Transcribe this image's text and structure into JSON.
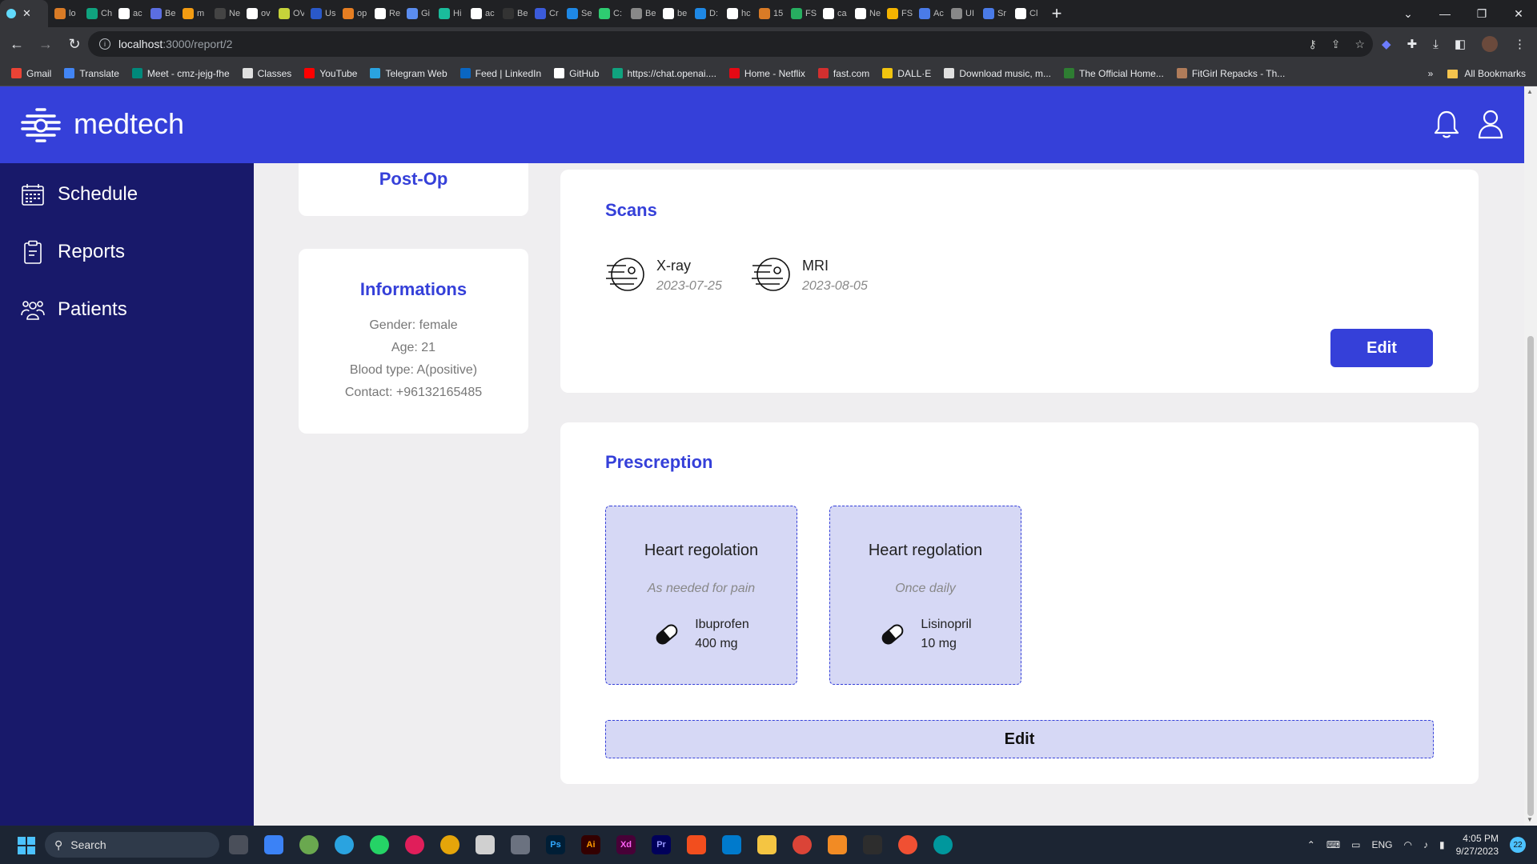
{
  "browser": {
    "tabs": [
      {
        "label": "lo",
        "color": "#d97b26"
      },
      {
        "label": "Ch",
        "color": "#10a37f"
      },
      {
        "label": "ac",
        "color": "#ffffff"
      },
      {
        "label": "Be",
        "color": "#5b6ee1"
      },
      {
        "label": "m",
        "color": "#f39c12"
      },
      {
        "label": "Ne",
        "color": "#444444"
      },
      {
        "label": "ov",
        "color": "#ffffff"
      },
      {
        "label": "OV",
        "color": "#c6d33a"
      },
      {
        "label": "Us",
        "color": "#2a59c9"
      },
      {
        "label": "op",
        "color": "#e67e22"
      },
      {
        "label": "Re",
        "color": "#ffffff"
      },
      {
        "label": "Gi",
        "color": "#5b8def"
      },
      {
        "label": "Hi",
        "color": "#1abc9c"
      },
      {
        "label": "ac",
        "color": "#ffffff"
      },
      {
        "label": "Be",
        "color": "#333333"
      },
      {
        "label": "Cr",
        "color": "#3b5bdb"
      },
      {
        "label": "Se",
        "color": "#1e88e5"
      },
      {
        "label": "C:",
        "color": "#2ecc71"
      },
      {
        "label": "Be",
        "color": "#888888"
      },
      {
        "label": "be",
        "color": "#ffffff"
      },
      {
        "label": "D:",
        "color": "#1e88e5"
      },
      {
        "label": "hc",
        "color": "#ffffff"
      },
      {
        "label": "15",
        "color": "#d97b26"
      },
      {
        "label": "FS",
        "color": "#27ae60"
      },
      {
        "label": "ca",
        "color": "#ffffff"
      },
      {
        "label": "Ne",
        "color": "#ffffff"
      },
      {
        "label": "FS",
        "color": "#f4b400"
      },
      {
        "label": "Ac",
        "color": "#4a7be8"
      },
      {
        "label": "UI",
        "color": "#888888"
      },
      {
        "label": "Sr",
        "color": "#4a7be8"
      },
      {
        "label": "Cl",
        "color": "#ffffff"
      }
    ],
    "url_host": "localhost",
    "url_path": ":3000/report/2",
    "bookmarks": [
      {
        "label": "Gmail",
        "color": "#ea4335"
      },
      {
        "label": "Translate",
        "color": "#4285f4"
      },
      {
        "label": "Meet - cmz-jejg-fhe",
        "color": "#00897b"
      },
      {
        "label": "Classes",
        "color": "#e0e0e0"
      },
      {
        "label": "YouTube",
        "color": "#ff0000"
      },
      {
        "label": "Telegram Web",
        "color": "#2aa3e0"
      },
      {
        "label": "Feed | LinkedIn",
        "color": "#0a66c2"
      },
      {
        "label": "GitHub",
        "color": "#ffffff"
      },
      {
        "label": "https://chat.openai....",
        "color": "#10a37f"
      },
      {
        "label": "Home - Netflix",
        "color": "#e50914"
      },
      {
        "label": "fast.com",
        "color": "#d32f2f"
      },
      {
        "label": "DALL·E",
        "color": "#f1c40f"
      },
      {
        "label": "Download music, m...",
        "color": "#e0e0e0"
      },
      {
        "label": "The Official Home...",
        "color": "#2e7d32"
      },
      {
        "label": "FitGirl Repacks - Th...",
        "color": "#b07c5a"
      }
    ],
    "all_bookmarks": "All Bookmarks"
  },
  "app": {
    "brand": "medtech",
    "accent": "#3540d9",
    "sidebar_bg": "#18196a",
    "sidebar": [
      {
        "label": "Schedule",
        "icon": "calendar-icon"
      },
      {
        "label": "Reports",
        "icon": "clipboard-icon"
      },
      {
        "label": "Patients",
        "icon": "people-icon"
      }
    ],
    "status_card": {
      "title": "Post-Op"
    },
    "info_card": {
      "title": "Informations",
      "gender": "Gender: female",
      "age": "Age: 21",
      "blood": "Blood type: A(positive)",
      "contact": "Contact: +96132165485"
    },
    "scans": {
      "title": "Scans",
      "items": [
        {
          "name": "X-ray",
          "date": "2023-07-25"
        },
        {
          "name": "MRI",
          "date": "2023-08-05"
        }
      ],
      "edit_label": "Edit"
    },
    "prescription": {
      "title": "Prescreption",
      "items": [
        {
          "title": "Heart regolation",
          "frequency": "As needed for pain",
          "drug": "Ibuprofen",
          "dose": "400 mg"
        },
        {
          "title": "Heart regolation",
          "frequency": "Once daily",
          "drug": "Lisinopril",
          "dose": "10 mg"
        }
      ],
      "edit_label": "Edit"
    }
  },
  "taskbar": {
    "search_placeholder": "Search",
    "lang": "ENG",
    "time": "4:05 PM",
    "date": "9/27/2023",
    "notifications": "22"
  }
}
